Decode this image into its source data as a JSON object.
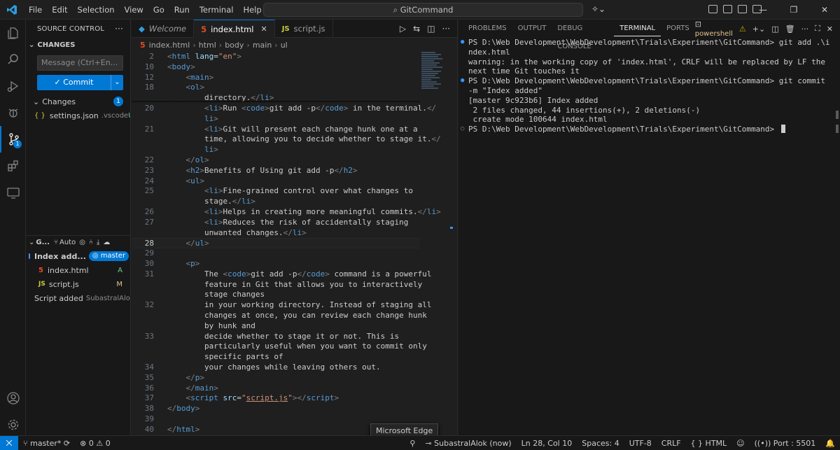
{
  "titlebar": {
    "menus": [
      "File",
      "Edit",
      "Selection",
      "View",
      "Go",
      "Run",
      "Terminal",
      "Help"
    ],
    "search": "GitCommand"
  },
  "sidebar": {
    "title": "SOURCE CONTROL",
    "changes_section": "CHANGES",
    "message_placeholder": "Message (Ctrl+En...",
    "commit_label": "Commit",
    "changes_group": "Changes",
    "changes_count": "1",
    "changed_file": {
      "name": "settings.json",
      "dir": ".vscode",
      "status": "U"
    },
    "graph_title": "G...",
    "graph_mode": "Auto",
    "graph": [
      {
        "message": "Index add...",
        "branch": "master"
      },
      {
        "message": "Script added",
        "author": "SubastralAlok"
      }
    ],
    "graph_files": [
      {
        "name": "index.html",
        "status": "A"
      },
      {
        "name": "script.js",
        "status": "M"
      }
    ]
  },
  "editor": {
    "tabs": [
      {
        "label": "Welcome"
      },
      {
        "label": "index.html"
      },
      {
        "label": "script.js"
      }
    ],
    "breadcrumb": [
      "index.html",
      "html",
      "body",
      "main",
      "ul"
    ],
    "lines": [
      {
        "n": "2",
        "html": "<span class='p'>&lt;</span><span class='t'>html</span> <span class='a'>lang</span>=<span class='s'>\"en\"</span><span class='p'>&gt;</span>",
        "cls": "sticky"
      },
      {
        "n": "10",
        "html": "<span class='p'>&lt;</span><span class='t'>body</span><span class='p'>&gt;</span>",
        "cls": "sticky"
      },
      {
        "n": "12",
        "html": "    <span class='p'>&lt;</span><span class='t'>main</span><span class='p'>&gt;</span>",
        "cls": "sticky"
      },
      {
        "n": "18",
        "html": "    <span class='p'>&lt;</span><span class='t'>ol</span><span class='p'>&gt;</span>",
        "cls": "sticky"
      },
      {
        "n": "",
        "html": "        directory.<span class='p'>&lt;/</span><span class='t'>li</span><span class='p'>&gt;</span>",
        "cls": ""
      },
      {
        "n": "20",
        "html": "        <span class='p'>&lt;</span><span class='t'>li</span><span class='p'>&gt;</span>Run <span class='p'>&lt;</span><span class='t'>code</span><span class='p'>&gt;</span>git add -p<span class='p'>&lt;/</span><span class='t'>code</span><span class='p'>&gt;</span> in the terminal.<span class='p'>&lt;/</span>",
        "cls": ""
      },
      {
        "n": "",
        "html": "        <span class='t'>li</span><span class='p'>&gt;</span>",
        "cls": ""
      },
      {
        "n": "21",
        "html": "        <span class='p'>&lt;</span><span class='t'>li</span><span class='p'>&gt;</span>Git will present each change hunk one at a",
        "cls": ""
      },
      {
        "n": "",
        "html": "        time, allowing you to decide whether to stage it.<span class='p'>&lt;/</span>",
        "cls": ""
      },
      {
        "n": "",
        "html": "        <span class='t'>li</span><span class='p'>&gt;</span>",
        "cls": ""
      },
      {
        "n": "22",
        "html": "    <span class='p'>&lt;/</span><span class='t'>ol</span><span class='p'>&gt;</span>",
        "cls": ""
      },
      {
        "n": "23",
        "html": "    <span class='p'>&lt;</span><span class='t'>h2</span><span class='p'>&gt;</span>Benefits of Using git add -p<span class='p'>&lt;/</span><span class='t'>h2</span><span class='p'>&gt;</span>",
        "cls": ""
      },
      {
        "n": "24",
        "html": "    <span class='p'>&lt;</span><span class='t'>ul</span><span class='p'>&gt;</span>",
        "cls": ""
      },
      {
        "n": "25",
        "html": "        <span class='p'>&lt;</span><span class='t'>li</span><span class='p'>&gt;</span>Fine-grained control over what changes to",
        "cls": ""
      },
      {
        "n": "",
        "html": "        stage.<span class='p'>&lt;/</span><span class='t'>li</span><span class='p'>&gt;</span>",
        "cls": ""
      },
      {
        "n": "26",
        "html": "        <span class='p'>&lt;</span><span class='t'>li</span><span class='p'>&gt;</span>Helps in creating more meaningful commits.<span class='p'>&lt;/</span><span class='t'>li</span><span class='p'>&gt;</span>",
        "cls": ""
      },
      {
        "n": "27",
        "html": "        <span class='p'>&lt;</span><span class='t'>li</span><span class='p'>&gt;</span>Reduces the risk of accidentally staging",
        "cls": ""
      },
      {
        "n": "",
        "html": "        unwanted changes.<span class='p'>&lt;/</span><span class='t'>li</span><span class='p'>&gt;</span>",
        "cls": ""
      },
      {
        "n": "28",
        "html": "    <span class='p'>&lt;/</span><span class='t'>ul</span><span class='p'>&gt;</span>",
        "cls": "cur"
      },
      {
        "n": "29",
        "html": "",
        "cls": ""
      },
      {
        "n": "30",
        "html": "    <span class='p'>&lt;</span><span class='t'>p</span><span class='p'>&gt;</span>",
        "cls": ""
      },
      {
        "n": "31",
        "html": "        The <span class='p'>&lt;</span><span class='t'>code</span><span class='p'>&gt;</span>git add -p<span class='p'>&lt;/</span><span class='t'>code</span><span class='p'>&gt;</span> command is a powerful",
        "cls": ""
      },
      {
        "n": "",
        "html": "        feature in Git that allows you to interactively",
        "cls": ""
      },
      {
        "n": "",
        "html": "        stage changes",
        "cls": ""
      },
      {
        "n": "32",
        "html": "        in your working directory. Instead of staging all",
        "cls": ""
      },
      {
        "n": "",
        "html": "        changes at once, you can review each change hunk",
        "cls": ""
      },
      {
        "n": "",
        "html": "        by hunk and",
        "cls": ""
      },
      {
        "n": "33",
        "html": "        decide whether to stage it or not. This is",
        "cls": ""
      },
      {
        "n": "",
        "html": "        particularly useful when you want to commit only",
        "cls": ""
      },
      {
        "n": "",
        "html": "        specific parts of",
        "cls": ""
      },
      {
        "n": "34",
        "html": "        your changes while leaving others out.",
        "cls": ""
      },
      {
        "n": "35",
        "html": "    <span class='p'>&lt;/</span><span class='t'>p</span><span class='p'>&gt;</span>",
        "cls": ""
      },
      {
        "n": "36",
        "html": "    <span class='p'>&lt;/</span><span class='t'>main</span><span class='p'>&gt;</span>",
        "cls": ""
      },
      {
        "n": "37",
        "html": "    <span class='p'>&lt;</span><span class='t'>script</span> <span class='a'>src</span>=<span class='s'>\"<u>script.js</u>\"</span><span class='p'>&gt;&lt;/</span><span class='t'>script</span><span class='p'>&gt;</span>",
        "cls": ""
      },
      {
        "n": "38",
        "html": "<span class='p'>&lt;/</span><span class='t'>body</span><span class='p'>&gt;</span>",
        "cls": ""
      },
      {
        "n": "39",
        "html": "",
        "cls": ""
      },
      {
        "n": "40",
        "html": "<span class='p'>&lt;/</span><span class='t'>html</span><span class='p'>&gt;</span>",
        "cls": ""
      }
    ]
  },
  "panel": {
    "tabs": [
      "PROBLEMS",
      "OUTPUT",
      "DEBUG CONSOLE",
      "TERMINAL",
      "PORTS"
    ],
    "active_tab": "TERMINAL",
    "shell": "powershell",
    "terminal": [
      {
        "mark": "filled",
        "text": "PS D:\\Web Development\\WebDevelopment\\Trials\\Experiment\\GitCommand> git add .\\index.html"
      },
      {
        "mark": "",
        "text": "warning: in the working copy of 'index.html', CRLF will be replaced by LF the next time Git touches it"
      },
      {
        "mark": "filled",
        "text": "PS D:\\Web Development\\WebDevelopment\\Trials\\Experiment\\GitCommand> git commit -m \"Index added\""
      },
      {
        "mark": "",
        "text": "[master 9c923b6] Index added"
      },
      {
        "mark": "",
        "text": " 2 files changed, 44 insertions(+), 2 deletions(-)"
      },
      {
        "mark": "",
        "text": " create mode 100644 index.html"
      },
      {
        "mark": "hollow",
        "text": "PS D:\\Web Development\\WebDevelopment\\Trials\\Experiment\\GitCommand> "
      }
    ]
  },
  "statusbar": {
    "branch": "master*",
    "errors": "0",
    "warnings": "0",
    "author": "SubastralAlok (now)",
    "position": "Ln 28, Col 10",
    "spaces": "Spaces: 4",
    "encoding": "UTF-8",
    "eol": "CRLF",
    "language": "HTML",
    "port": "Port : 5501"
  },
  "tooltip": "Microsoft Edge",
  "colors": {
    "accent": "#0078d4",
    "added": "#73c991",
    "modified": "#e2c08d"
  }
}
